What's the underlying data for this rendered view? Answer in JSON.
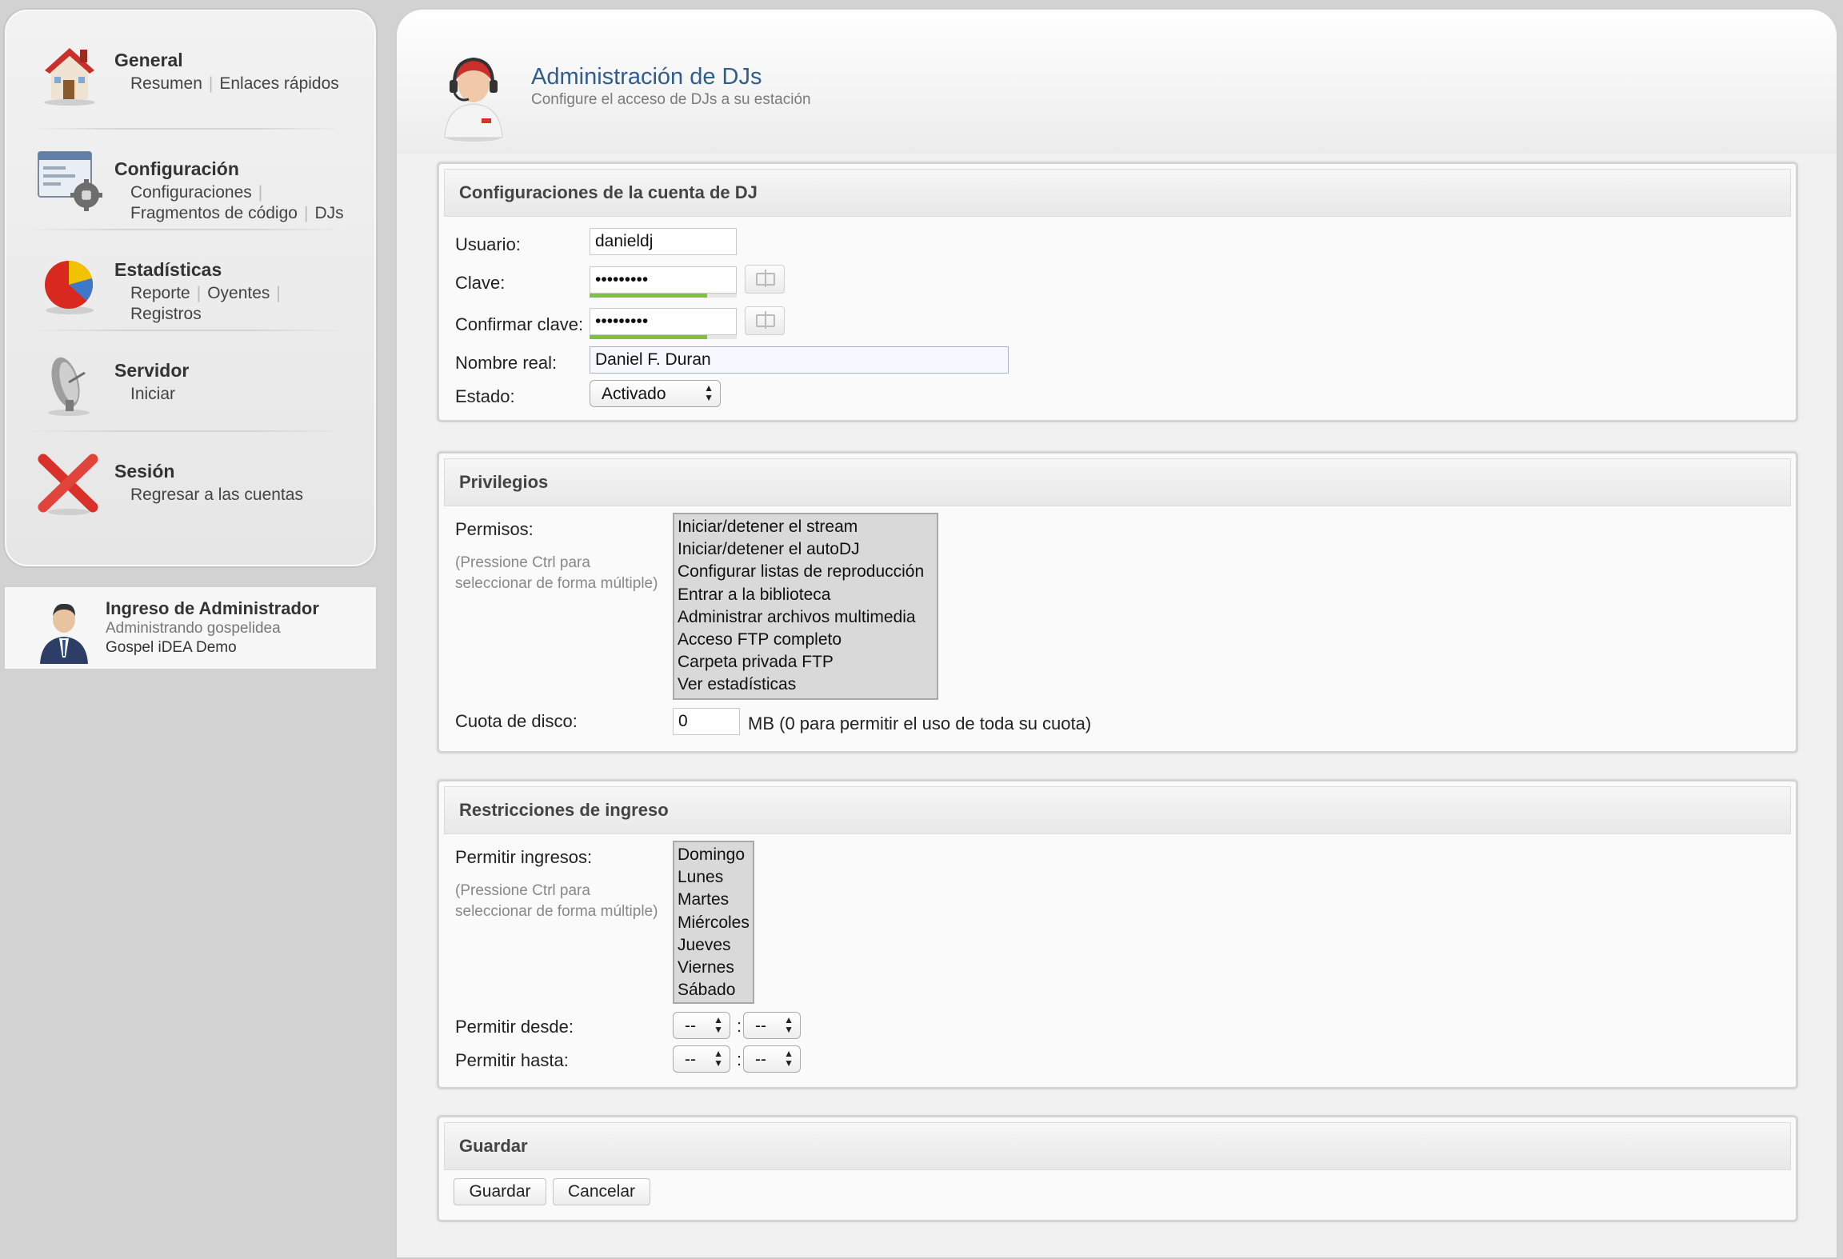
{
  "sidebar": {
    "general": {
      "title": "General",
      "links": [
        "Resumen",
        "Enlaces rápidos"
      ]
    },
    "config": {
      "title": "Configuración",
      "links": [
        "Configuraciones",
        "Fragmentos de código",
        "DJs"
      ]
    },
    "stats": {
      "title": "Estadísticas",
      "links": [
        "Reporte",
        "Oyentes",
        "Registros"
      ]
    },
    "server": {
      "title": "Servidor",
      "links": [
        "Iniciar"
      ]
    },
    "session": {
      "title": "Sesión",
      "links": [
        "Regresar a las cuentas"
      ]
    }
  },
  "admin": {
    "title": "Ingreso de Administrador",
    "subtitle": "Administrando gospelidea",
    "station": "Gospel iDEA Demo"
  },
  "header": {
    "title": "Administración de DJs",
    "subtitle": "Configure el acceso de DJs a su estación"
  },
  "account": {
    "heading": "Configuraciones de la cuenta de DJ",
    "user_label": "Usuario:",
    "user_value": "danieldj",
    "pass_label": "Clave:",
    "pass_value": "•••••••••",
    "pass_strength": 0.8,
    "confirm_label": "Confirmar clave:",
    "confirm_value": "•••••••••",
    "confirm_strength": 0.8,
    "realname_label": "Nombre real:",
    "realname_value": "Daniel F. Duran",
    "status_label": "Estado:",
    "status_value": "Activado"
  },
  "privileges": {
    "heading": "Privilegios",
    "perm_label": "Permisos:",
    "hint_line1": "(Pressione Ctrl para",
    "hint_line2": "seleccionar de forma múltiple)",
    "options": [
      "Iniciar/detener el stream",
      "Iniciar/detener el autoDJ",
      "Configurar listas de reproducción",
      "Entrar a la biblioteca",
      "Administrar archivos multimedia",
      "Acceso FTP completo",
      "Carpeta privada FTP",
      "Ver estadísticas"
    ],
    "quota_label": "Cuota de disco:",
    "quota_value": "0",
    "quota_note": "MB (0 para permitir el uso de toda su cuota)"
  },
  "restrictions": {
    "heading": "Restricciones de ingreso",
    "allow_label": "Permitir ingresos:",
    "hint_line1": "(Pressione Ctrl para",
    "hint_line2": "seleccionar de forma múltiple)",
    "days": [
      "Domingo",
      "Lunes",
      "Martes",
      "Miércoles",
      "Jueves",
      "Viernes",
      "Sábado"
    ],
    "from_label": "Permitir desde:",
    "to_label": "Permitir hasta:",
    "time_placeholder": "--",
    "colon": ":"
  },
  "save": {
    "heading": "Guardar",
    "save_label": "Guardar",
    "cancel_label": "Cancelar"
  }
}
